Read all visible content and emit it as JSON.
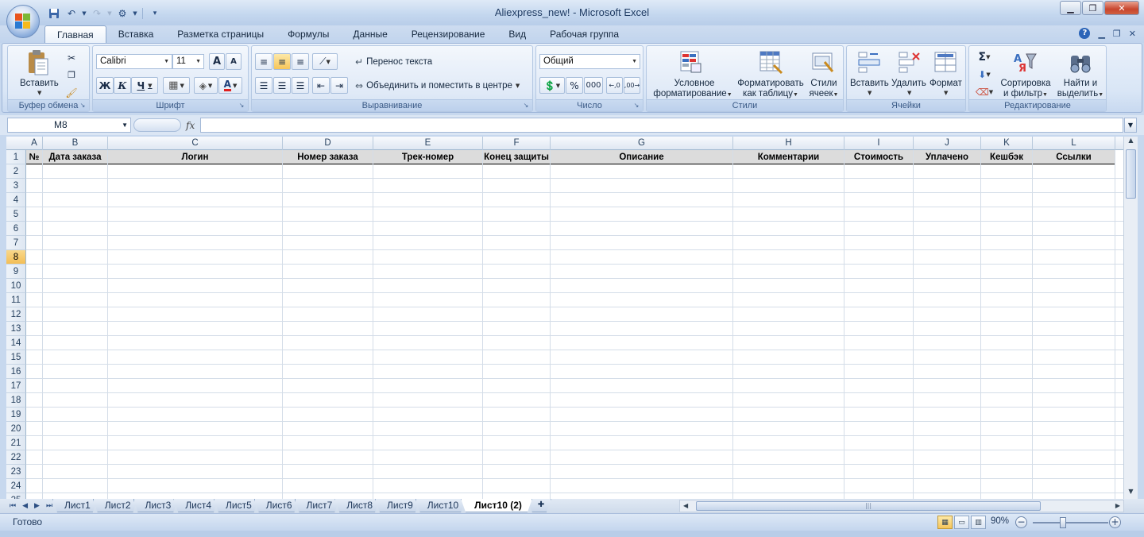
{
  "window": {
    "title": "Aliexpress_new! - Microsoft Excel",
    "minimize": "▁",
    "restore": "❐",
    "close": "✕"
  },
  "qat": {
    "save_icon": "save-icon",
    "undo_icon": "undo-icon",
    "redo_icon": "redo-icon"
  },
  "tabs": [
    "Главная",
    "Вставка",
    "Разметка страницы",
    "Формулы",
    "Данные",
    "Рецензирование",
    "Вид",
    "Рабочая группа"
  ],
  "active_tab": "Главная",
  "ribbon": {
    "clipboard": {
      "label": "Буфер обмена",
      "paste": "Вставить"
    },
    "font": {
      "label": "Шрифт",
      "name": "Calibri",
      "size": "11",
      "bold": "Ж",
      "italic": "К",
      "underline": "Ч",
      "grow": "A",
      "shrink": "A"
    },
    "alignment": {
      "label": "Выравнивание",
      "wrap": "Перенос текста",
      "merge": "Объединить и поместить в центре"
    },
    "number": {
      "label": "Число",
      "format": "Общий",
      "percent": "%",
      "thousands": "000",
      "inc_decimal": ",0\n,00",
      "dec_decimal": ",00\n,0"
    },
    "styles": {
      "label": "Стили",
      "conditional": "Условное",
      "conditional2": "форматирование",
      "as_table": "Форматировать",
      "as_table2": "как таблицу",
      "cell_styles": "Стили",
      "cell_styles2": "ячеек"
    },
    "cells": {
      "label": "Ячейки",
      "insert": "Вставить",
      "delete": "Удалить",
      "format": "Формат"
    },
    "editing": {
      "label": "Редактирование",
      "sigma": "Σ",
      "sort": "Сортировка",
      "sort2": "и фильтр",
      "find": "Найти и",
      "find2": "выделить"
    }
  },
  "formula_bar": {
    "name_box": "M8",
    "fx": "fx",
    "formula": ""
  },
  "columns": [
    "A",
    "B",
    "C",
    "D",
    "E",
    "F",
    "G",
    "H",
    "I",
    "J",
    "K",
    "L"
  ],
  "rows": [
    "1",
    "2",
    "3",
    "4",
    "5",
    "6",
    "7",
    "8",
    "9",
    "10",
    "11",
    "12",
    "13",
    "14",
    "15",
    "16",
    "17",
    "18",
    "19",
    "20",
    "21",
    "22",
    "23",
    "24",
    "25"
  ],
  "active_row": "8",
  "header_row": [
    "№",
    "Дата заказа",
    "Логин",
    "Номер заказа",
    "Трек-номер",
    "Конец защиты",
    "Описание",
    "Комментарии",
    "Стоимость",
    "Уплачено",
    "Кешбэк",
    "Ссылки"
  ],
  "sheets": [
    "Лист1",
    "Лист2",
    "Лист3",
    "Лист4",
    "Лист5",
    "Лист6",
    "Лист7",
    "Лист8",
    "Лист9",
    "Лист10",
    "Лист10 (2)"
  ],
  "active_sheet": "Лист10 (2)",
  "status": {
    "text": "Готово",
    "zoom": "90%"
  }
}
